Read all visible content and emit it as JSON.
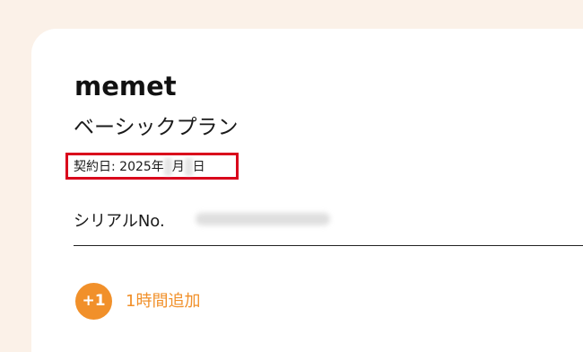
{
  "app": {
    "name": "memet"
  },
  "plan": {
    "name": "ベーシックプラン",
    "contract_label": "契約日:",
    "contract_year": "2025年",
    "contract_month_blur": "3",
    "contract_month_suffix": "月",
    "contract_day_blur": "4",
    "contract_day_suffix": "日"
  },
  "serial": {
    "label": "シリアルNo."
  },
  "actions": {
    "add_time_badge": "+1",
    "add_time_label": "1時間追加"
  },
  "colors": {
    "background": "#fbf1e8",
    "accent": "#f1902a",
    "highlight": "#d9001b"
  }
}
